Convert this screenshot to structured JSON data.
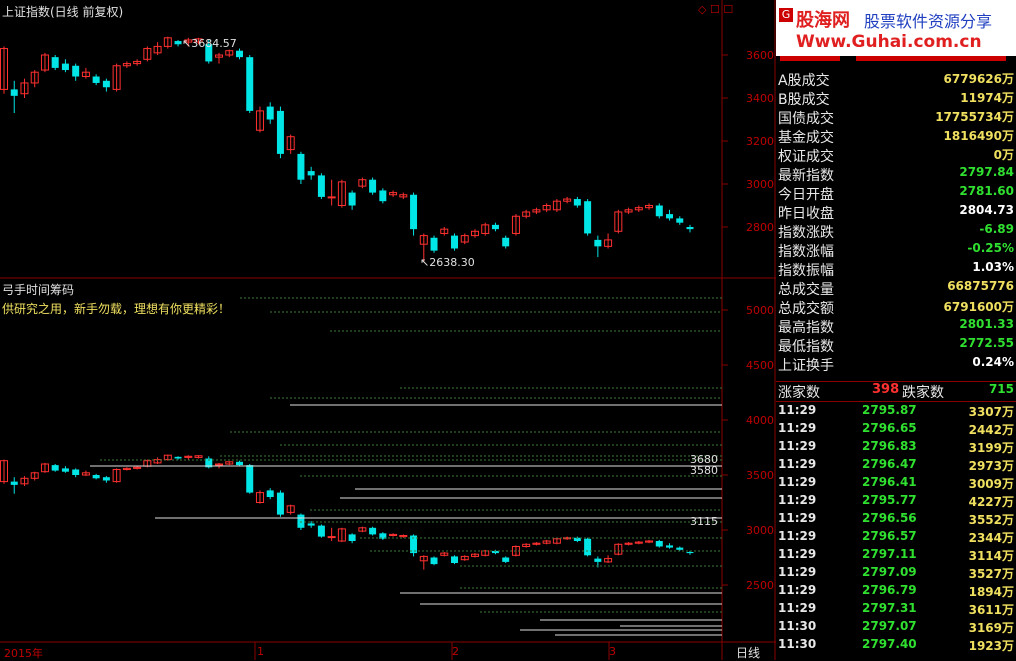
{
  "chart": {
    "title": "上证指数(日线 前复权)",
    "corner_icons": "◇ ☐ ☐",
    "period": "日线",
    "upper_axis": [
      "3600",
      "3400",
      "3200",
      "3000",
      "2800"
    ],
    "high_label": "3684.57",
    "low_label": "2638.30",
    "lower_title": "弓手时间筹码",
    "lower_note": "供研究之用，新手勿载，理想有你更精彩！",
    "lower_axis": [
      "5000",
      "4500",
      "4000",
      "3500",
      "3000",
      "2500"
    ],
    "lower_labels": [
      "3680",
      "3580",
      "3115"
    ],
    "x_labels": [
      "2015年",
      "1",
      "2",
      "3"
    ]
  },
  "chart_data": {
    "type": "candlestick",
    "title": "上证指数(日线 前复权)",
    "ylim": [
      2600,
      3700
    ],
    "x_labels": [
      "2015年",
      "1",
      "2",
      "3"
    ],
    "annotations": [
      {
        "label": "3684.57",
        "kind": "high"
      },
      {
        "label": "2638.30",
        "kind": "low"
      }
    ],
    "candles": [
      {
        "o": 3440,
        "c": 3630,
        "h": 3640,
        "l": 3420
      },
      {
        "o": 3440,
        "c": 3410,
        "h": 3480,
        "l": 3330
      },
      {
        "o": 3420,
        "c": 3470,
        "h": 3490,
        "l": 3400
      },
      {
        "o": 3470,
        "c": 3520,
        "h": 3530,
        "l": 3450
      },
      {
        "o": 3530,
        "c": 3600,
        "h": 3610,
        "l": 3520
      },
      {
        "o": 3590,
        "c": 3540,
        "h": 3600,
        "l": 3530
      },
      {
        "o": 3560,
        "c": 3530,
        "h": 3580,
        "l": 3520
      },
      {
        "o": 3550,
        "c": 3500,
        "h": 3560,
        "l": 3480
      },
      {
        "o": 3500,
        "c": 3520,
        "h": 3540,
        "l": 3490
      },
      {
        "o": 3500,
        "c": 3470,
        "h": 3510,
        "l": 3460
      },
      {
        "o": 3480,
        "c": 3450,
        "h": 3490,
        "l": 3430
      },
      {
        "o": 3440,
        "c": 3550,
        "h": 3560,
        "l": 3430
      },
      {
        "o": 3550,
        "c": 3560,
        "h": 3570,
        "l": 3540
      },
      {
        "o": 3560,
        "c": 3570,
        "h": 3580,
        "l": 3550
      },
      {
        "o": 3580,
        "c": 3630,
        "h": 3640,
        "l": 3570
      },
      {
        "o": 3610,
        "c": 3640,
        "h": 3660,
        "l": 3600
      },
      {
        "o": 3640,
        "c": 3680,
        "h": 3685,
        "l": 3630
      },
      {
        "o": 3665,
        "c": 3650,
        "h": 3670,
        "l": 3640
      },
      {
        "o": 3660,
        "c": 3670,
        "h": 3680,
        "l": 3640
      },
      {
        "o": 3660,
        "c": 3675,
        "h": 3680,
        "l": 3650
      },
      {
        "o": 3650,
        "c": 3570,
        "h": 3670,
        "l": 3560
      },
      {
        "o": 3590,
        "c": 3600,
        "h": 3610,
        "l": 3560
      },
      {
        "o": 3600,
        "c": 3620,
        "h": 3625,
        "l": 3590
      },
      {
        "o": 3620,
        "c": 3590,
        "h": 3630,
        "l": 3580
      },
      {
        "o": 3590,
        "c": 3340,
        "h": 3600,
        "l": 3330
      },
      {
        "o": 3250,
        "c": 3340,
        "h": 3360,
        "l": 3240
      },
      {
        "o": 3360,
        "c": 3300,
        "h": 3380,
        "l": 3280
      },
      {
        "o": 3340,
        "c": 3140,
        "h": 3360,
        "l": 3120
      },
      {
        "o": 3160,
        "c": 3220,
        "h": 3230,
        "l": 3140
      },
      {
        "o": 3140,
        "c": 3020,
        "h": 3150,
        "l": 3000
      },
      {
        "o": 3060,
        "c": 3040,
        "h": 3080,
        "l": 3020
      },
      {
        "o": 3040,
        "c": 2940,
        "h": 3050,
        "l": 2930
      },
      {
        "o": 2940,
        "c": 2940,
        "h": 3020,
        "l": 2900
      },
      {
        "o": 2900,
        "c": 3010,
        "h": 3020,
        "l": 2890
      },
      {
        "o": 2960,
        "c": 2900,
        "h": 2970,
        "l": 2880
      },
      {
        "o": 2990,
        "c": 3020,
        "h": 3030,
        "l": 2980
      },
      {
        "o": 3020,
        "c": 2960,
        "h": 3030,
        "l": 2950
      },
      {
        "o": 2970,
        "c": 2920,
        "h": 2980,
        "l": 2910
      },
      {
        "o": 2950,
        "c": 2960,
        "h": 2970,
        "l": 2940
      },
      {
        "o": 2940,
        "c": 2950,
        "h": 2960,
        "l": 2930
      },
      {
        "o": 2950,
        "c": 2790,
        "h": 2960,
        "l": 2760
      },
      {
        "o": 2720,
        "c": 2760,
        "h": 2770,
        "l": 2640
      },
      {
        "o": 2750,
        "c": 2690,
        "h": 2760,
        "l": 2680
      },
      {
        "o": 2770,
        "c": 2790,
        "h": 2800,
        "l": 2760
      },
      {
        "o": 2760,
        "c": 2700,
        "h": 2770,
        "l": 2690
      },
      {
        "o": 2730,
        "c": 2760,
        "h": 2770,
        "l": 2720
      },
      {
        "o": 2760,
        "c": 2780,
        "h": 2790,
        "l": 2750
      },
      {
        "o": 2770,
        "c": 2810,
        "h": 2820,
        "l": 2760
      },
      {
        "o": 2810,
        "c": 2790,
        "h": 2820,
        "l": 2780
      },
      {
        "o": 2750,
        "c": 2710,
        "h": 2760,
        "l": 2700
      },
      {
        "o": 2770,
        "c": 2850,
        "h": 2860,
        "l": 2760
      },
      {
        "o": 2850,
        "c": 2870,
        "h": 2880,
        "l": 2840
      },
      {
        "o": 2870,
        "c": 2880,
        "h": 2890,
        "l": 2860
      },
      {
        "o": 2880,
        "c": 2900,
        "h": 2910,
        "l": 2870
      },
      {
        "o": 2880,
        "c": 2920,
        "h": 2930,
        "l": 2870
      },
      {
        "o": 2920,
        "c": 2930,
        "h": 2940,
        "l": 2910
      },
      {
        "o": 2930,
        "c": 2900,
        "h": 2940,
        "l": 2890
      },
      {
        "o": 2920,
        "c": 2770,
        "h": 2930,
        "l": 2760
      },
      {
        "o": 2740,
        "c": 2710,
        "h": 2760,
        "l": 2660
      },
      {
        "o": 2710,
        "c": 2740,
        "h": 2770,
        "l": 2700
      },
      {
        "o": 2780,
        "c": 2870,
        "h": 2880,
        "l": 2770
      },
      {
        "o": 2870,
        "c": 2880,
        "h": 2890,
        "l": 2860
      },
      {
        "o": 2880,
        "c": 2890,
        "h": 2900,
        "l": 2870
      },
      {
        "o": 2890,
        "c": 2900,
        "h": 2910,
        "l": 2880
      },
      {
        "o": 2900,
        "c": 2850,
        "h": 2910,
        "l": 2840
      },
      {
        "o": 2860,
        "c": 2840,
        "h": 2880,
        "l": 2830
      },
      {
        "o": 2840,
        "c": 2820,
        "h": 2850,
        "l": 2810
      },
      {
        "o": 2800,
        "c": 2790,
        "h": 2810,
        "l": 2775
      }
    ]
  },
  "quote": {
    "logo_g": "G",
    "logo_name": "股海网",
    "logo_sub": "股票软件资源分享",
    "logo_url": "Www.Guhai.com.cn",
    "rows": [
      {
        "k": "A股成交",
        "v": "6779626万",
        "c": "yellow"
      },
      {
        "k": "B股成交",
        "v": "11974万",
        "c": "yellow"
      },
      {
        "k": "国债成交",
        "v": "17755734万",
        "c": "yellow"
      },
      {
        "k": "基金成交",
        "v": "1816490万",
        "c": "yellow"
      },
      {
        "k": "权证成交",
        "v": "0万",
        "c": "yellow"
      },
      {
        "k": "最新指数",
        "v": "2797.84",
        "c": "green"
      },
      {
        "k": "今日开盘",
        "v": "2781.60",
        "c": "green"
      },
      {
        "k": "昨日收盘",
        "v": "2804.73",
        "c": "white"
      },
      {
        "k": "指数涨跌",
        "v": "-6.89",
        "c": "green"
      },
      {
        "k": "指数涨幅",
        "v": "-0.25%",
        "c": "green"
      },
      {
        "k": "指数振幅",
        "v": "1.03%",
        "c": "white"
      },
      {
        "k": "总成交量",
        "v": "66875776",
        "c": "yellow"
      },
      {
        "k": "总成交额",
        "v": "6791600万",
        "c": "yellow"
      },
      {
        "k": "最高指数",
        "v": "2801.33",
        "c": "green"
      },
      {
        "k": "最低指数",
        "v": "2772.55",
        "c": "green"
      },
      {
        "k": "上证换手",
        "v": "0.24%",
        "c": "white"
      }
    ],
    "breadth": {
      "up_label": "涨家数",
      "up": "398",
      "down_label": "跌家数",
      "down": "715"
    },
    "ticks": [
      {
        "t": "11:29",
        "p": "2795.87",
        "v": "3307万"
      },
      {
        "t": "11:29",
        "p": "2796.65",
        "v": "2442万"
      },
      {
        "t": "11:29",
        "p": "2796.83",
        "v": "3199万"
      },
      {
        "t": "11:29",
        "p": "2796.47",
        "v": "2973万"
      },
      {
        "t": "11:29",
        "p": "2796.41",
        "v": "3009万"
      },
      {
        "t": "11:29",
        "p": "2795.77",
        "v": "4227万"
      },
      {
        "t": "11:29",
        "p": "2796.56",
        "v": "3552万"
      },
      {
        "t": "11:29",
        "p": "2796.57",
        "v": "2344万"
      },
      {
        "t": "11:29",
        "p": "2797.11",
        "v": "3114万"
      },
      {
        "t": "11:29",
        "p": "2797.09",
        "v": "3527万"
      },
      {
        "t": "11:29",
        "p": "2796.79",
        "v": "1894万"
      },
      {
        "t": "11:29",
        "p": "2797.31",
        "v": "3611万"
      },
      {
        "t": "11:30",
        "p": "2797.07",
        "v": "3169万"
      },
      {
        "t": "11:30",
        "p": "2797.40",
        "v": "1923万"
      }
    ]
  }
}
